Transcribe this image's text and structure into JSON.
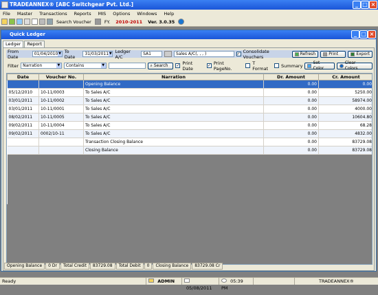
{
  "window": {
    "title": "TRADEANNEX® [ABC Switchgear Pvt. Ltd.]"
  },
  "menu": [
    "File",
    "Master",
    "Transactions",
    "Reports",
    "MIS",
    "Options",
    "Windows",
    "Help"
  ],
  "toolbar": {
    "search_label": "Search Voucher",
    "fy_label": "FY.",
    "fy_value": "2010-2011",
    "version": "Ver. 3.0.35"
  },
  "child": {
    "title": "Quick Ledger"
  },
  "tabs": [
    "Ledger",
    "Report"
  ],
  "filters": {
    "from_label": "From Date",
    "from_value": "01/04/2010",
    "to_label": "To Date",
    "to_value": "31/03/2011",
    "ledger_label": "Ledger A/C",
    "ledger_code": "SA1",
    "ledger_name": "Sales A/C(, , , )",
    "consolidate_label": "Consolidate Vouchers",
    "refresh_label": "Refresh",
    "print_label": "Print",
    "export_label": "Export",
    "filter_label": "Filter",
    "filter_field": "Narration",
    "filter_op": "Contains",
    "filter_text": "",
    "search_btn": "Search",
    "print_date_label": "Print Date",
    "print_pageno_label": "Print PageNo.",
    "tformat_label": "T Format",
    "summary_label": "Summary",
    "set_color_label": "Set Color",
    "clear_colors_label": "Clear Colors"
  },
  "grid": {
    "headers": [
      "Date",
      "Voucher No.",
      "Narration",
      "Dr. Amount",
      "Cr. Amount"
    ],
    "rows": [
      [
        "",
        "",
        "Opening Balance",
        "0.00",
        "0.00"
      ],
      [
        "05/12/2010",
        "10-11/0003",
        "To Sales A/C",
        "0.00",
        "5250.00"
      ],
      [
        "03/01/2011",
        "10-11/0002",
        "To Sales A/C",
        "0.00",
        "58974.00"
      ],
      [
        "03/01/2011",
        "10-11/0001",
        "To Sales A/C",
        "0.00",
        "4000.00"
      ],
      [
        "08/02/2011",
        "10-11/0005",
        "To Sales A/C",
        "0.00",
        "10604.80"
      ],
      [
        "09/02/2011",
        "10-11/0004",
        "To Sales A/C",
        "0.00",
        "68.28"
      ],
      [
        "09/02/2011",
        "0002/10-11",
        "To Sales A/C",
        "0.00",
        "4832.00"
      ],
      [
        "",
        "",
        "Transaction Closing Balance",
        "0.00",
        "83729.08"
      ],
      [
        "",
        "",
        "Closing Balance",
        "0.00",
        "83729.08"
      ]
    ]
  },
  "footer": [
    "Opening Balance",
    "0 Dr",
    "Total Credit",
    "83729.08",
    "Total Debit",
    "0",
    "Closing Balance",
    "83729.08 Cr"
  ],
  "status": {
    "ready": "Ready",
    "user": "ADMIN",
    "date": "05/08/2011",
    "time": "05:39 PM",
    "brand": "TRADEANNEX®"
  }
}
